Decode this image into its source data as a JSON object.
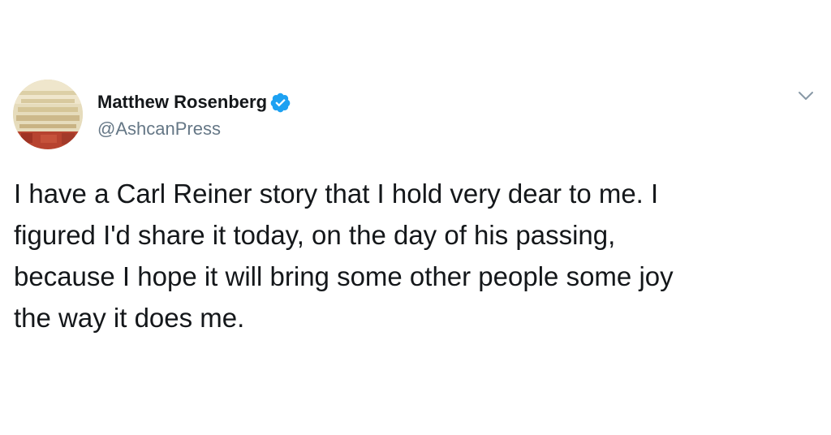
{
  "tweet": {
    "author": {
      "display_name": "Matthew Rosenberg",
      "handle": "@AshcanPress",
      "verified": true
    },
    "text": "I have a Carl Reiner story that I hold very dear to me. I\nfigured I'd share it today, on the day of his passing,\nbecause I hope it will bring some other people some joy\nthe way it does me.",
    "icons": {
      "verified": "verified-badge-icon",
      "menu": "chevron-down-icon"
    },
    "colors": {
      "verified_badge": "#1da1f2",
      "handle": "#657786",
      "text": "#14171a",
      "chevron": "#8899a6"
    }
  }
}
